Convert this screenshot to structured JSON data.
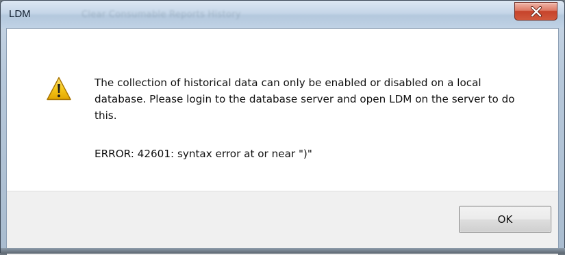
{
  "window": {
    "title": "LDM",
    "background_title_blur": "Clear Consumable Reports History",
    "close_icon": "close-x-icon"
  },
  "dialog": {
    "icon": "warning-icon",
    "message": "The collection of historical data can only be enabled or disabled on a local database. Please login to the database server and open LDM on the server to do this.",
    "error": "ERROR: 42601: syntax error at or near \")\"",
    "ok_label": "OK"
  },
  "colors": {
    "close_button": "#c6432b",
    "warning_fill": "#f2c312",
    "dialog_footer": "#f0f0f0"
  }
}
